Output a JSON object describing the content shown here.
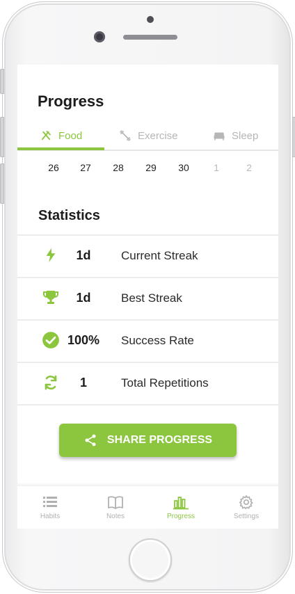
{
  "page": {
    "title": "Progress"
  },
  "tabs": [
    {
      "label": "Food",
      "icon": "fork-knife-icon",
      "active": true
    },
    {
      "label": "Exercise",
      "icon": "dumbbell-icon",
      "active": false
    },
    {
      "label": "Sleep",
      "icon": "bed-icon",
      "active": false
    }
  ],
  "dates": [
    "26",
    "27",
    "28",
    "29",
    "30",
    "1",
    "2"
  ],
  "statistics": {
    "title": "Statistics",
    "rows": [
      {
        "icon": "lightning-icon",
        "value": "1d",
        "label": "Current Streak"
      },
      {
        "icon": "trophy-icon",
        "value": "1d",
        "label": "Best Streak"
      },
      {
        "icon": "check-circle-icon",
        "value": "100%",
        "label": "Success Rate"
      },
      {
        "icon": "repeat-icon",
        "value": "1",
        "label": "Total Repetitions"
      }
    ]
  },
  "share_button": {
    "label": "SHARE PROGRESS",
    "icon": "share-icon"
  },
  "bottom_nav": [
    {
      "label": "Habits",
      "icon": "list-icon",
      "active": false
    },
    {
      "label": "Notes",
      "icon": "book-icon",
      "active": false
    },
    {
      "label": "Progress",
      "icon": "bar-chart-icon",
      "active": true
    },
    {
      "label": "Settings",
      "icon": "gear-icon",
      "active": false
    }
  ],
  "colors": {
    "accent": "#8cc63f",
    "muted": "#b6b6b6",
    "text": "#1c1c1c"
  }
}
